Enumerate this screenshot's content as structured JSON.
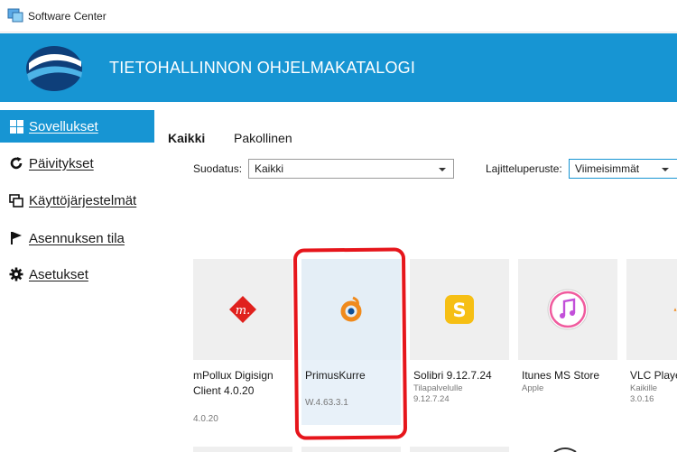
{
  "window": {
    "title": "Software Center"
  },
  "banner": {
    "title": "TIETOHALLINNON OHJELMAKATALOGI"
  },
  "sidebar": {
    "items": [
      {
        "label": "Sovellukset",
        "icon": "grid-icon",
        "active": true
      },
      {
        "label": "Päivitykset",
        "icon": "refresh-icon",
        "active": false
      },
      {
        "label": "Käyttöjärjestelmät",
        "icon": "windows-os-icon",
        "active": false
      },
      {
        "label": "Asennuksen tila",
        "icon": "flag-icon",
        "active": false
      },
      {
        "label": "Asetukset",
        "icon": "gear-icon",
        "active": false
      }
    ]
  },
  "tabs": [
    {
      "label": "Kaikki",
      "active": true
    },
    {
      "label": "Pakollinen",
      "active": false
    }
  ],
  "filters": {
    "filter_label": "Suodatus:",
    "filter_value": "Kaikki",
    "sort_label": "Lajitteluperuste:",
    "sort_value": "Viimeisimmät"
  },
  "apps": [
    {
      "name": "mPollux Digisign Client 4.0.20",
      "publisher": "",
      "version": "4.0.20",
      "icon": "mpollux-icon"
    },
    {
      "name": "PrimusKurre",
      "publisher": "",
      "version": "W.4.63.3.1",
      "icon": "primuskurre-icon",
      "selected": true
    },
    {
      "name": "Solibri 9.12.7.24",
      "publisher": "Tilapalvelulle",
      "version": "9.12.7.24",
      "icon": "solibri-icon"
    },
    {
      "name": "Itunes MS Store",
      "publisher": "Apple",
      "version": "",
      "icon": "itunes-icon"
    },
    {
      "name": "VLC Playe",
      "publisher": "Kaikille",
      "version": "3.0.16",
      "icon": "vlc-icon"
    }
  ],
  "colors": {
    "accent": "#1795d3",
    "annotation": "#e6151b",
    "selected_card": "#e8f1f9"
  }
}
